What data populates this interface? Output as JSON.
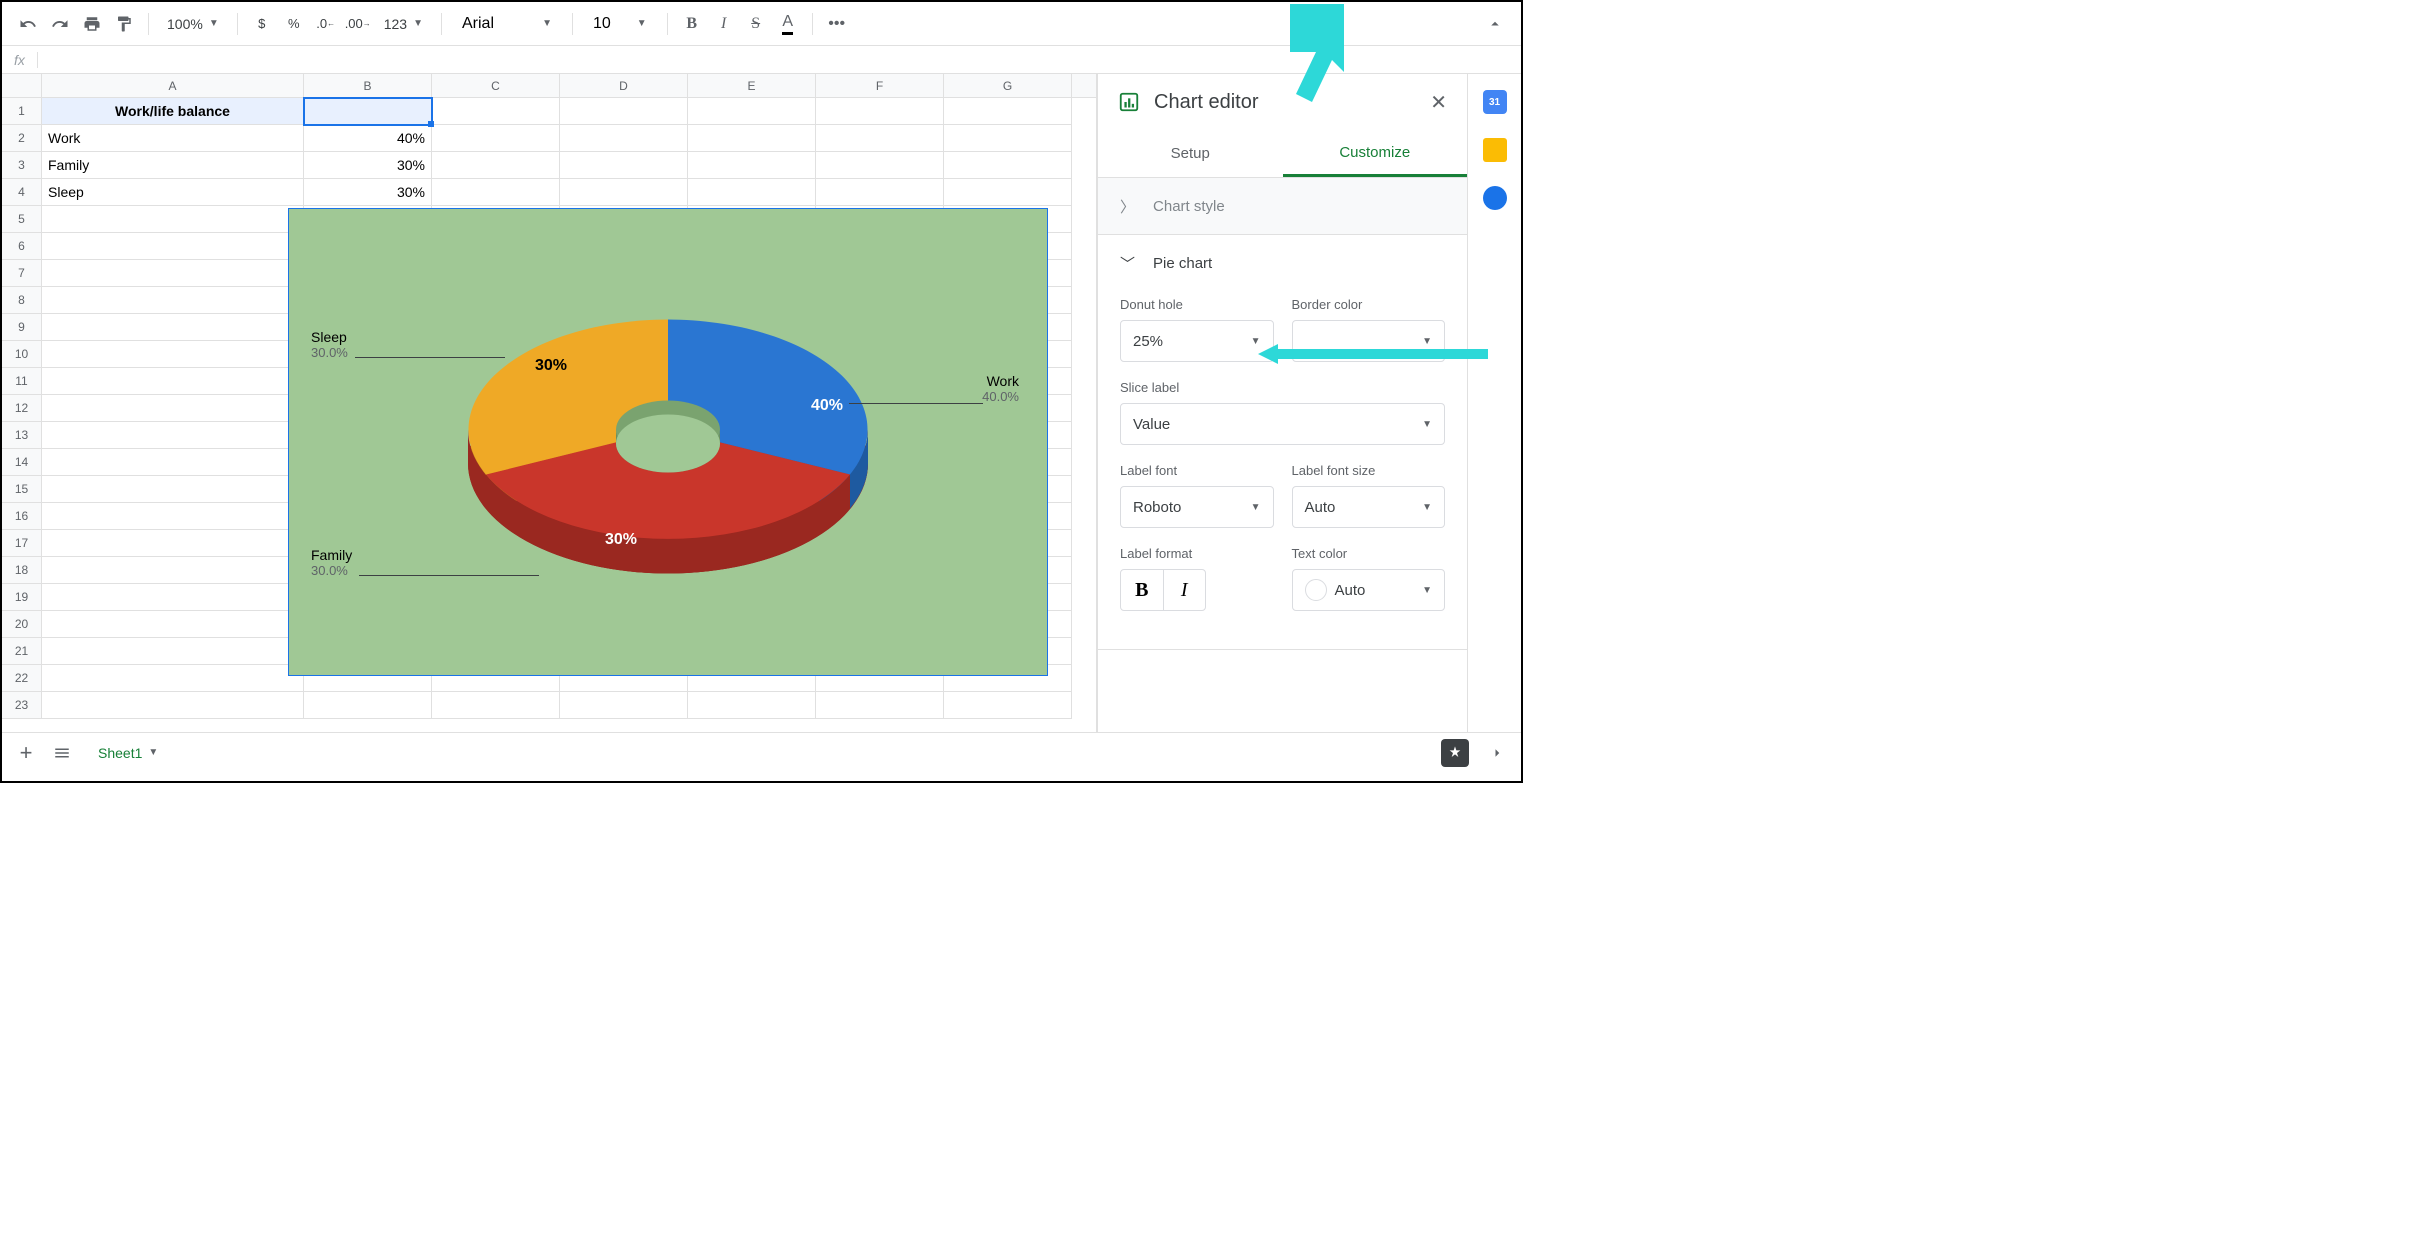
{
  "toolbar": {
    "zoom": "100%",
    "font": "Arial",
    "font_size": "10",
    "decimal_dec": ".0",
    "decimal_inc": ".00",
    "number_format": "123"
  },
  "columns": [
    "A",
    "B",
    "C",
    "D",
    "E",
    "F",
    "G"
  ],
  "rows": [
    {
      "n": "1",
      "a": "Work/life balance",
      "b": "",
      "a_bold": true,
      "a_hl": true,
      "b_active": true
    },
    {
      "n": "2",
      "a": "Work",
      "b": "40%"
    },
    {
      "n": "3",
      "a": "Family",
      "b": "30%"
    },
    {
      "n": "4",
      "a": "Sleep",
      "b": "30%"
    },
    {
      "n": "5"
    },
    {
      "n": "6"
    },
    {
      "n": "7"
    },
    {
      "n": "8"
    },
    {
      "n": "9"
    },
    {
      "n": "10"
    },
    {
      "n": "11"
    },
    {
      "n": "12"
    },
    {
      "n": "13"
    },
    {
      "n": "14"
    },
    {
      "n": "15"
    },
    {
      "n": "16"
    },
    {
      "n": "17"
    },
    {
      "n": "18"
    },
    {
      "n": "19"
    },
    {
      "n": "20"
    },
    {
      "n": "21"
    },
    {
      "n": "22"
    },
    {
      "n": "23"
    }
  ],
  "chart_data": {
    "type": "pie",
    "title": "",
    "categories": [
      "Work",
      "Family",
      "Sleep"
    ],
    "values": [
      40,
      30,
      30
    ],
    "colors": [
      "#2a76d2",
      "#c9362b",
      "#efa926"
    ],
    "donut_hole": 0.25,
    "labels": [
      {
        "name": "Work",
        "pct": "40.0%",
        "slice": "40%"
      },
      {
        "name": "Family",
        "pct": "30.0%",
        "slice": "30%"
      },
      {
        "name": "Sleep",
        "pct": "30.0%",
        "slice": "30%"
      }
    ]
  },
  "panel": {
    "title": "Chart editor",
    "tabs": {
      "setup": "Setup",
      "customize": "Customize"
    },
    "sections": {
      "chart_style": "Chart style",
      "pie_chart": "Pie chart"
    },
    "fields": {
      "donut_hole": {
        "label": "Donut hole",
        "value": "25%"
      },
      "border_color": {
        "label": "Border color"
      },
      "slice_label": {
        "label": "Slice label",
        "value": "Value"
      },
      "label_font": {
        "label": "Label font",
        "value": "Roboto"
      },
      "label_font_size": {
        "label": "Label font size",
        "value": "Auto"
      },
      "label_format": {
        "label": "Label format"
      },
      "text_color": {
        "label": "Text color",
        "value": "Auto"
      },
      "bold": "B",
      "italic": "I"
    }
  },
  "sheets": {
    "tab": "Sheet1"
  }
}
